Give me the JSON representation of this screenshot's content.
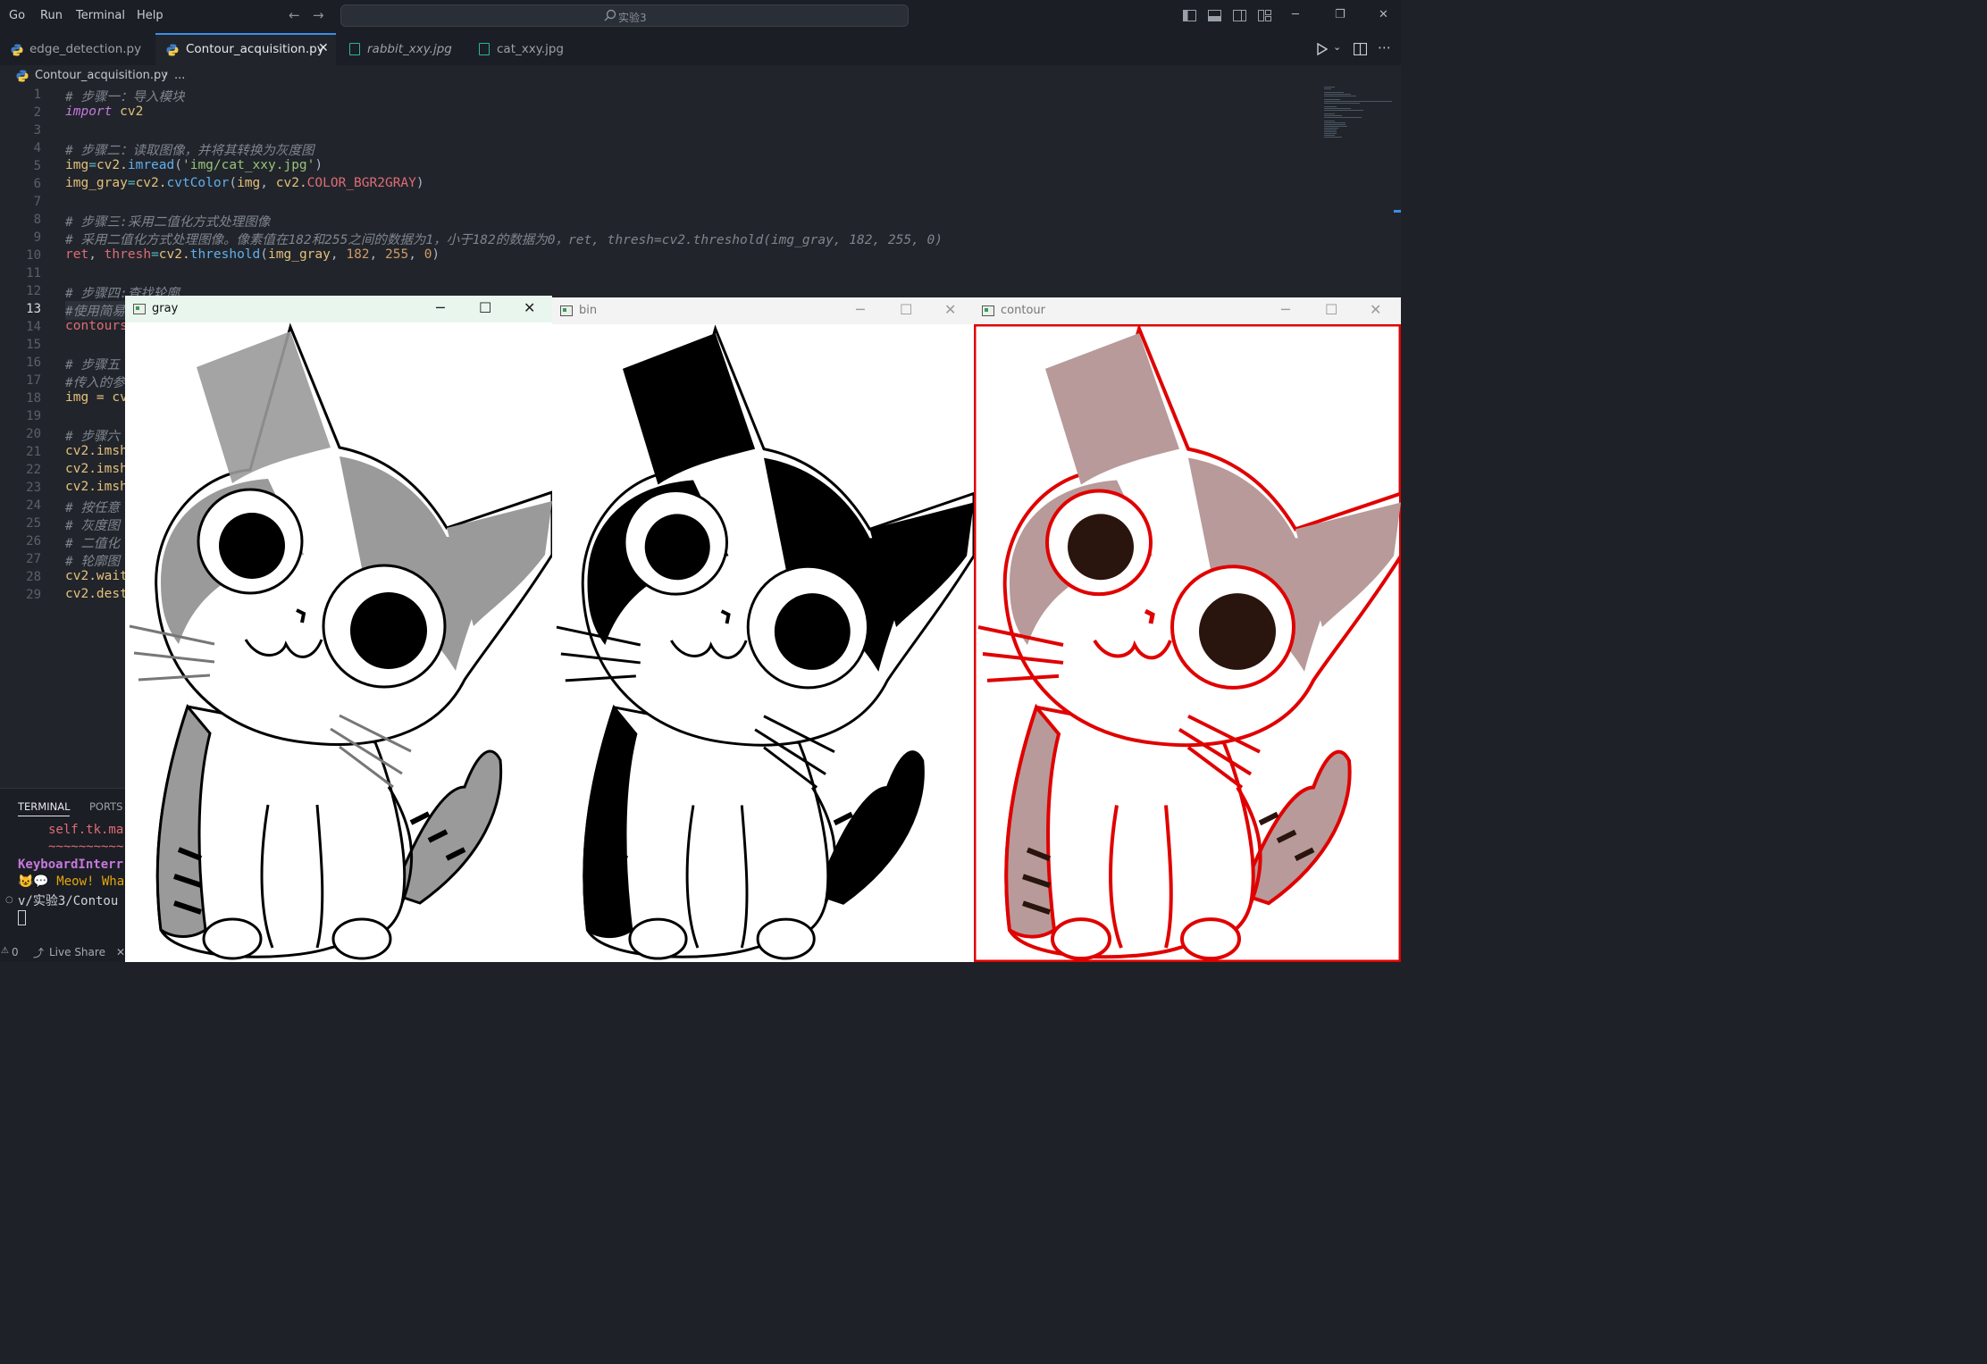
{
  "menu": [
    "Go",
    "Run",
    "Terminal",
    "Help"
  ],
  "search": {
    "text": "实验3"
  },
  "tabs": [
    {
      "label": "edge_detection.py",
      "kind": "py",
      "active": false
    },
    {
      "label": "Contour_acquisition.py",
      "kind": "py",
      "active": true
    },
    {
      "label": "rabbit_xxy.jpg",
      "kind": "img",
      "active": false
    },
    {
      "label": "cat_xxy.jpg",
      "kind": "img",
      "active": false
    }
  ],
  "breadcrumb": {
    "file": "Contour_acquisition.py",
    "rest": "..."
  },
  "current_line": 13,
  "code": [
    "# 步骤一：导入模块",
    "import cv2",
    "",
    "# 步骤二：读取图像，并将其转换为灰度图",
    "img=cv2.imread('img/cat_xxy.jpg')",
    "img_gray=cv2.cvtColor(img, cv2.COLOR_BGR2GRAY)",
    "",
    "# 步骤三:采用二值化方式处理图像",
    "# 采用二值化方式处理图像。像素值在182和255之间的数据为1，小于182的数据为0，ret, thresh=cv2.threshold(img_gray, 182, 255, 0)",
    "ret, thresh=cv2.threshold(img_gray, 182, 255, 0)",
    "",
    "# 步骤四:查找轮廓",
    "#使用简易",
    "contours",
    "",
    "# 步骤五",
    "#传入的参",
    "img = cv",
    "",
    "# 步骤六",
    "cv2.imsh",
    "cv2.imsh",
    "cv2.imsh",
    "# 按任意",
    "# 灰度图",
    "# 二值化",
    "# 轮廓图",
    "cv2.wait",
    "cv2.dest"
  ],
  "terminal": {
    "tabs": [
      "TERMINAL",
      "PORTS"
    ],
    "lines": [
      "self.tk.ma",
      "~~~~~~~~~~",
      "KeyboardInterr",
      "😺💬 Meow! Wha",
      "v/实验3/Contou"
    ]
  },
  "status": {
    "errors": "0",
    "live_share": "Live Share"
  },
  "windows": [
    {
      "title": "gray",
      "active": true
    },
    {
      "title": "bin",
      "active": false
    },
    {
      "title": "contour",
      "active": false
    }
  ],
  "colors": {
    "editor_bg": "#21252b",
    "accent": "#3b8eea",
    "contour": "#e00000"
  }
}
